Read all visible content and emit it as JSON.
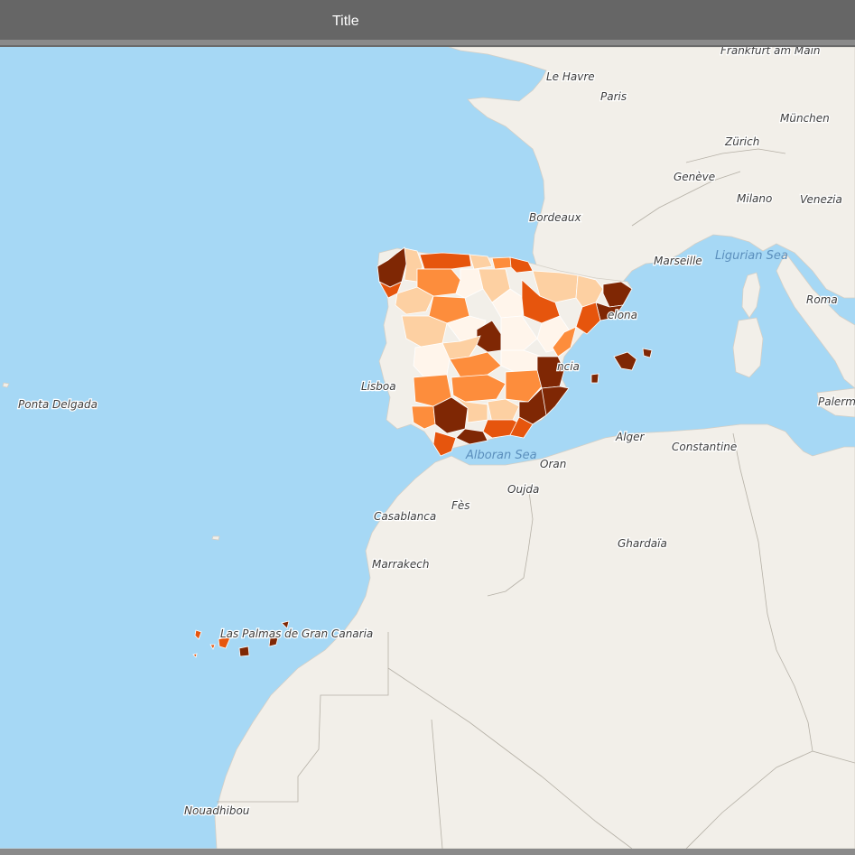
{
  "window": {
    "title": "Title"
  },
  "colors": {
    "sea": "#a6d8f5",
    "land": "#f2efe9",
    "choropleth_scale": [
      "#fff5eb",
      "#fdd0a2",
      "#fd8d3c",
      "#e6550d",
      "#7f2704"
    ]
  },
  "map": {
    "city_labels": [
      {
        "id": "le-havre",
        "text": "Le Havre"
      },
      {
        "id": "paris",
        "text": "Paris"
      },
      {
        "id": "frankfurt",
        "text": "Frankfurt am Main"
      },
      {
        "id": "munchen",
        "text": "München"
      },
      {
        "id": "zurich",
        "text": "Zürich"
      },
      {
        "id": "geneve",
        "text": "Genève"
      },
      {
        "id": "milano",
        "text": "Milano"
      },
      {
        "id": "venezia",
        "text": "Venezia"
      },
      {
        "id": "bordeaux",
        "text": "Bordeaux"
      },
      {
        "id": "marseille",
        "text": "Marseille"
      },
      {
        "id": "roma",
        "text": "Roma"
      },
      {
        "id": "lisboa",
        "text": "Lisboa"
      },
      {
        "id": "ponta-delgada",
        "text": "Ponta Delgada"
      },
      {
        "id": "alger",
        "text": "Alger"
      },
      {
        "id": "constantine",
        "text": "Constantine"
      },
      {
        "id": "oran",
        "text": "Oran"
      },
      {
        "id": "oujda",
        "text": "Oujda"
      },
      {
        "id": "fes",
        "text": "Fès"
      },
      {
        "id": "casablanca",
        "text": "Casablanca"
      },
      {
        "id": "ghardaia",
        "text": "Ghardaïa"
      },
      {
        "id": "marrakech",
        "text": "Marrakech"
      },
      {
        "id": "las-palmas",
        "text": "Las Palmas de Gran Canaria"
      },
      {
        "id": "nouadhibou",
        "text": "Nouadhibou"
      },
      {
        "id": "palermo",
        "text": "Palerm"
      },
      {
        "id": "barcelona",
        "text": "elona"
      },
      {
        "id": "valencia",
        "text": "ncia"
      }
    ],
    "sea_labels": [
      {
        "id": "ligurian-sea",
        "text": "Ligurian Sea"
      },
      {
        "id": "alboran-sea",
        "text": "Alboran Sea"
      }
    ]
  }
}
